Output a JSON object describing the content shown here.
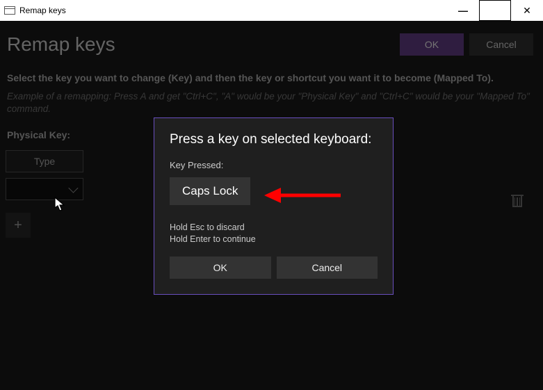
{
  "titlebar": {
    "title": "Remap keys"
  },
  "header": {
    "title": "Remap keys",
    "ok": "OK",
    "cancel": "Cancel"
  },
  "instruction": "Select the key you want to change (Key) and then the key or shortcut you want it to become (Mapped To).",
  "example": "Example of a remapping: Press A and get \"Ctrl+C\", \"A\" would be your \"Physical Key\" and \"Ctrl+C\" would be your \"Mapped To\" command.",
  "physical_key": {
    "label": "Physical Key:",
    "type_button": "Type"
  },
  "dialog": {
    "title": "Press a key on selected keyboard:",
    "key_pressed_label": "Key Pressed:",
    "key_value": "Caps Lock",
    "hint_discard": "Hold Esc to discard",
    "hint_continue": "Hold Enter to continue",
    "ok": "OK",
    "cancel": "Cancel"
  }
}
